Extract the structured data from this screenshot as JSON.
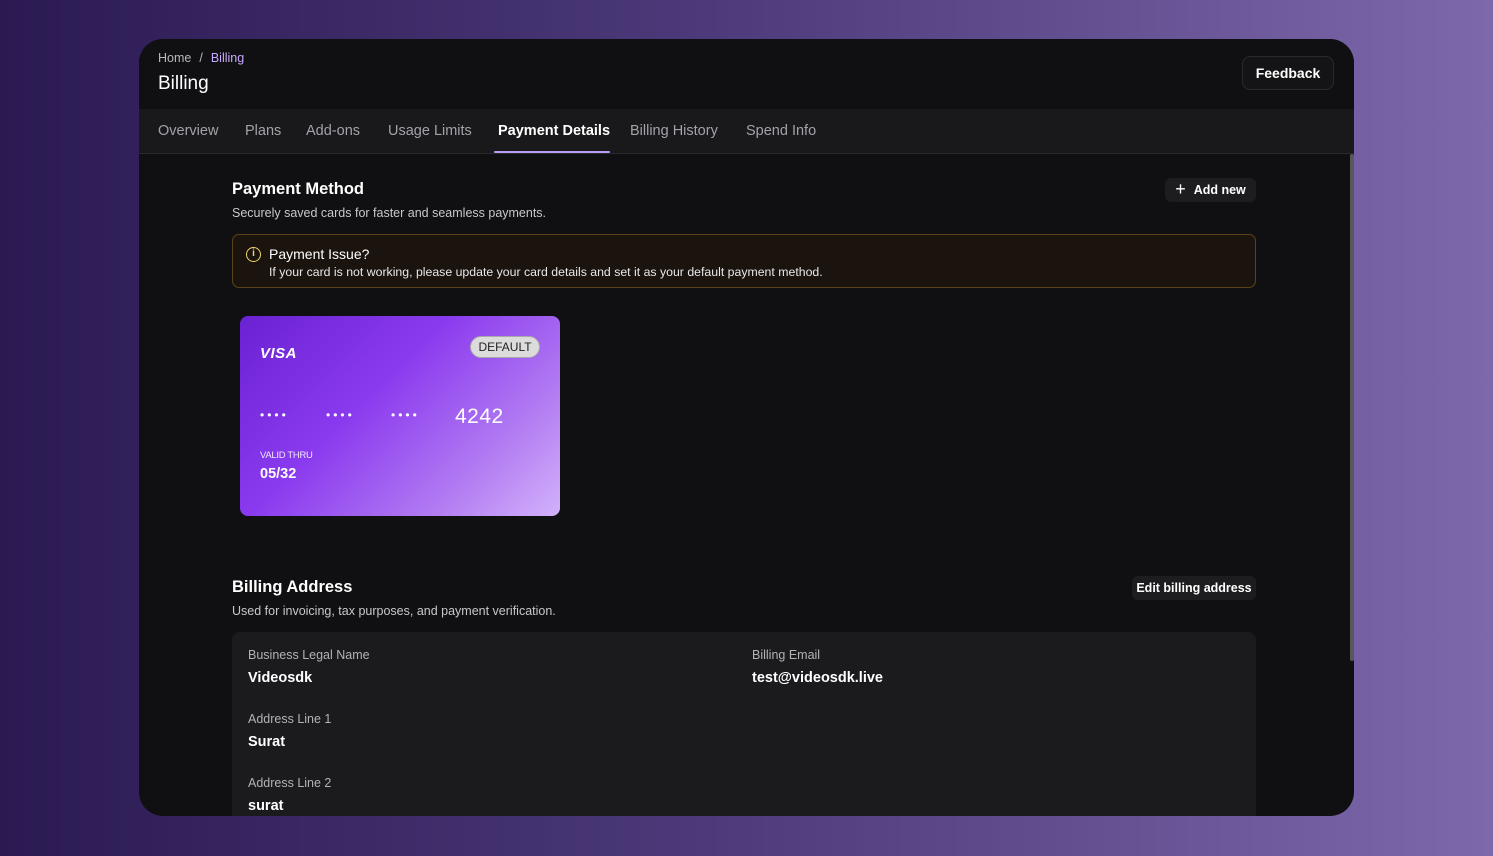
{
  "breadcrumb": {
    "home": "Home",
    "separator": "/",
    "current": "Billing"
  },
  "page_title": "Billing",
  "feedback_label": "Feedback",
  "tabs": [
    {
      "label": "Overview"
    },
    {
      "label": "Plans"
    },
    {
      "label": "Add-ons"
    },
    {
      "label": "Usage Limits"
    },
    {
      "label": "Payment Details",
      "active": true
    },
    {
      "label": "Billing History"
    },
    {
      "label": "Spend Info"
    }
  ],
  "payment_method": {
    "title": "Payment Method",
    "description": "Securely saved cards for faster and seamless payments.",
    "add_new_label": "Add new",
    "alert": {
      "icon": "info-icon",
      "title": "Payment Issue?",
      "text": "If your card is not working, please update your card details and set it as your default payment method."
    },
    "card": {
      "brand": "VISA",
      "badge": "DEFAULT",
      "masked_groups": [
        "••••",
        "••••",
        "••••"
      ],
      "last4": "4242",
      "valid_label": "VALID THRU",
      "valid_thru": "05/32"
    }
  },
  "billing_address": {
    "title": "Billing Address",
    "description": "Used for invoicing, tax purposes, and payment verification.",
    "edit_label": "Edit billing address",
    "fields": {
      "business_name": {
        "label": "Business Legal Name",
        "value": "Videosdk"
      },
      "billing_email": {
        "label": "Billing Email",
        "value": "test@videosdk.live"
      },
      "address_line_1": {
        "label": "Address Line 1",
        "value": "Surat"
      },
      "address_line_2": {
        "label": "Address Line 2",
        "value": "surat"
      }
    }
  },
  "colors": {
    "accent": "#c8a8ff",
    "card_gradient_start": "#6a22d2",
    "card_gradient_end": "#d2b2fb",
    "alert_border": "#5a4219",
    "alert_icon": "#f5d56a"
  }
}
